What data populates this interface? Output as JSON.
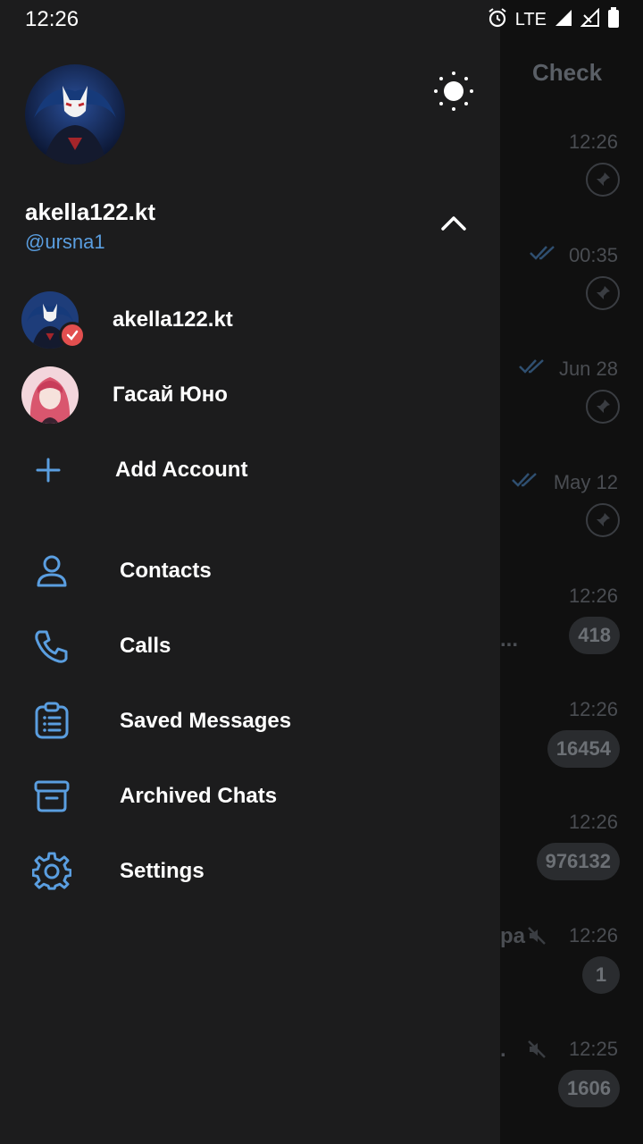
{
  "status_bar": {
    "time": "12:26",
    "network": "LTE"
  },
  "background": {
    "header_title": "Check",
    "rows": [
      {
        "time": "12:26",
        "pinned": true,
        "read": false
      },
      {
        "time": "00:35",
        "pinned": true,
        "read": true
      },
      {
        "time": "Jun 28",
        "pinned": true,
        "read": true
      },
      {
        "time": "May 12",
        "pinned": true,
        "read": true
      },
      {
        "time": "12:26",
        "badge": "418",
        "fragment": "..."
      },
      {
        "time": "12:26",
        "badge": "16454"
      },
      {
        "time": "12:26",
        "badge": "976132"
      },
      {
        "time": "12:26",
        "badge": "1",
        "fragment": "ра",
        "muted": true
      },
      {
        "time": "12:25",
        "badge": "1606",
        "fragment": ".",
        "muted": true
      }
    ]
  },
  "drawer": {
    "profile": {
      "name": "akella122.kt",
      "username": "@ursna1"
    },
    "accounts": [
      {
        "label": "akella122.kt",
        "active": true
      },
      {
        "label": "Гасай Юно",
        "active": false
      }
    ],
    "add_account_label": "Add Account",
    "menu": [
      {
        "label": "Contacts",
        "icon": "person-icon"
      },
      {
        "label": "Calls",
        "icon": "phone-icon"
      },
      {
        "label": "Saved Messages",
        "icon": "saved-messages-icon"
      },
      {
        "label": "Archived Chats",
        "icon": "archive-icon"
      },
      {
        "label": "Settings",
        "icon": "gear-icon"
      }
    ]
  },
  "colors": {
    "accent": "#5a9ee0",
    "drawer_bg": "#1c1c1d",
    "check_badge": "#e24f4f"
  }
}
